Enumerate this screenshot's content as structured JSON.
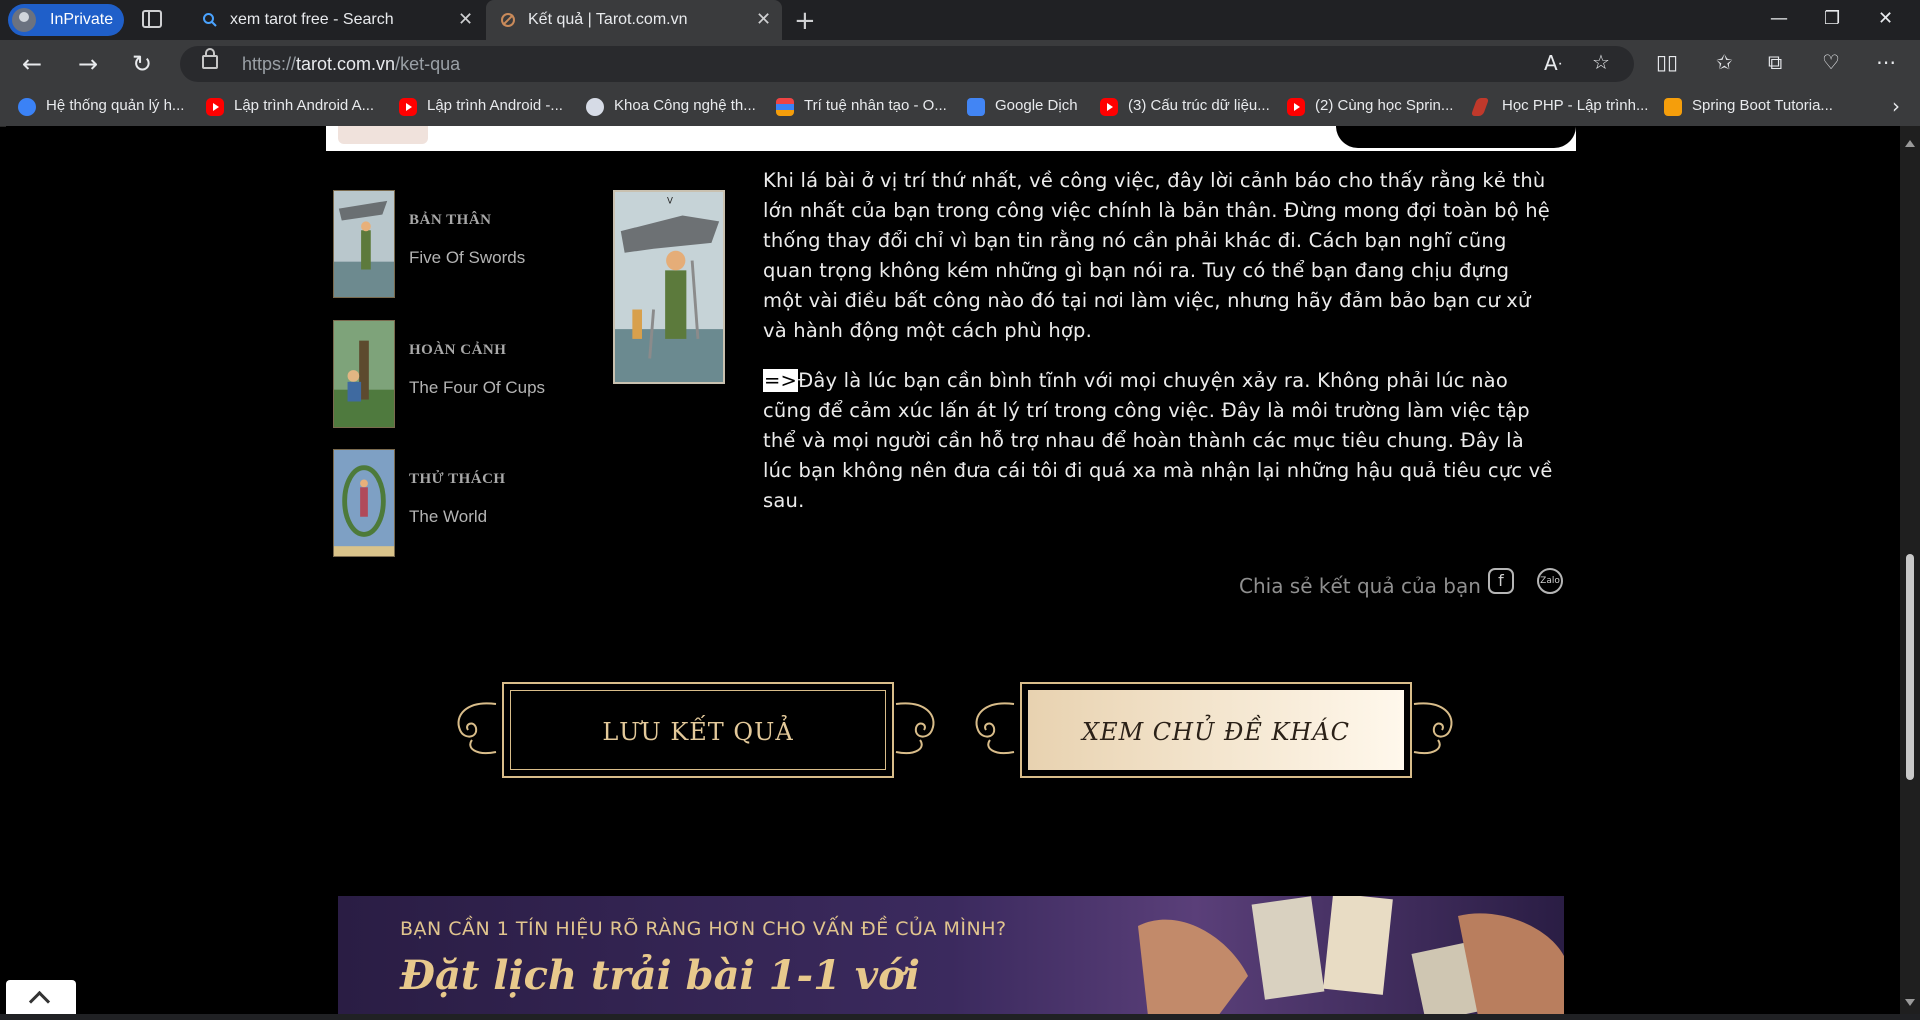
{
  "browser": {
    "inprivate_label": "InPrivate",
    "tabs": [
      {
        "title": "xem tarot free - Search"
      },
      {
        "title": "Kết quả | Tarot.com.vn"
      }
    ],
    "address": {
      "prefix": "https://",
      "domain": "tarot.com.vn",
      "path": "/ket-qua"
    },
    "bookmarks": [
      {
        "label": "Hệ thống quản lý h...",
        "icon": "blue"
      },
      {
        "label": "Lập trình Android A...",
        "icon": "youtube"
      },
      {
        "label": "Lập trình Android -...",
        "icon": "youtube"
      },
      {
        "label": "Khoa Công nghệ th...",
        "icon": "grey"
      },
      {
        "label": "Trí tuệ nhân tạo - O...",
        "icon": "stack"
      },
      {
        "label": "Google Dịch",
        "icon": "google-translate"
      },
      {
        "label": "(3) Cấu trúc dữ liệu...",
        "icon": "youtube"
      },
      {
        "label": "(2) Cùng học Sprin...",
        "icon": "youtube"
      },
      {
        "label": "Học PHP - Lập trình...",
        "icon": "php"
      },
      {
        "label": "Spring Boot Tutoria...",
        "icon": "spring"
      }
    ]
  },
  "positions": [
    {
      "title": "BẢN THÂN",
      "card": "Five Of Swords"
    },
    {
      "title": "HOÀN CẢNH",
      "card": "The Four Of Cups"
    },
    {
      "title": "THỬ THÁCH",
      "card": "The World"
    }
  ],
  "reading": {
    "p1": "Khi lá bài ở vị trí thứ nhất, về công việc, đây lời cảnh báo cho thấy rằng kẻ thù lớn nhất của bạn trong công việc chính là bản thân. Đừng mong đợi toàn bộ hệ thống thay đổi chỉ vì bạn tin rằng nó cần phải khác đi. Cách bạn nghĩ cũng quan trọng không kém những gì bạn nói ra. Tuy có thể bạn đang chịu đựng một vài điều bất công nào đó tại nơi làm việc, nhưng hãy đảm bảo bạn cư xử và hành động một cách phù hợp.",
    "p2_arrow": "=>",
    "p2": "Đây là lúc bạn cần bình tĩnh với mọi chuyện xảy ra. Không phải lúc nào cũng để cảm xúc lấn át lý trí trong công việc. Đây là môi trường làm việc tập thể và mọi người cần hỗ trợ nhau để hoàn thành các mục tiêu chung. Đây là lúc bạn không nên đưa cái tôi đi quá xa mà nhận lại những hậu quả tiêu cực về sau."
  },
  "share": {
    "label": "Chia sẻ kết quả của bạn",
    "zalo": "Zalo"
  },
  "buttons": {
    "save": "LƯU KẾT QUẢ",
    "other": "XEM CHỦ ĐỀ KHÁC"
  },
  "banner": {
    "line1": "BẠN CẦN 1 TÍN HIỆU RÕ RÀNG HƠN CHO VẤN ĐỀ CỦA MÌNH?",
    "line2": "Đặt lịch trải bài 1-1 với"
  },
  "colors": {
    "gold": "#d9bd8a",
    "background": "#000000",
    "browser_dark": "#202124"
  }
}
